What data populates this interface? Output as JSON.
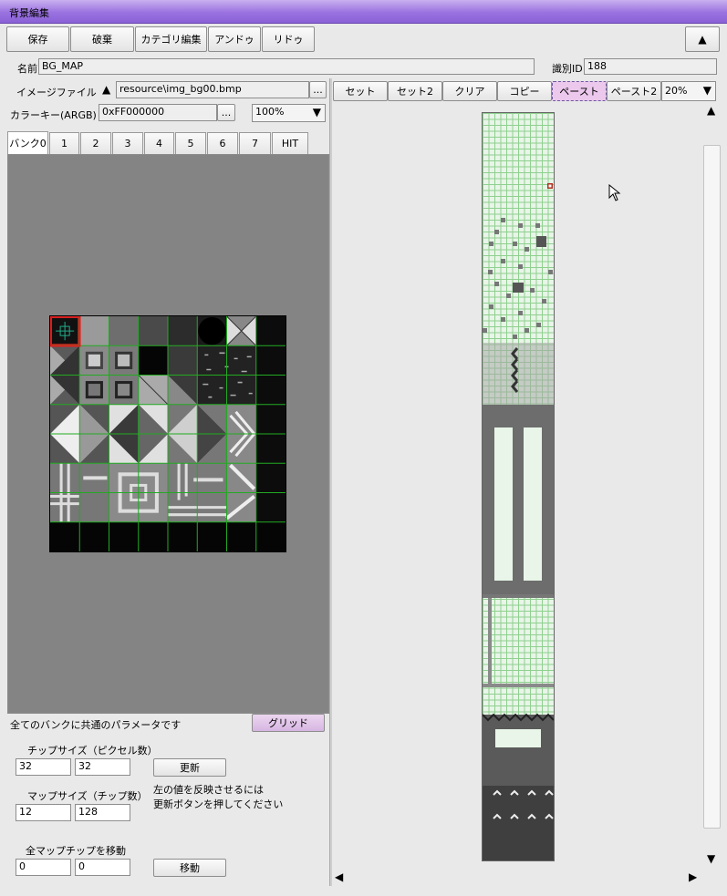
{
  "window": {
    "title": "背景編集"
  },
  "toolbar": {
    "save": "保存",
    "discard": "破棄",
    "category_edit": "カテゴリ編集",
    "undo": "アンドゥ",
    "redo": "リドゥ",
    "collapse": "▲"
  },
  "name_row": {
    "name_label": "名前",
    "name_value": "BG_MAP",
    "id_label": "識別ID",
    "id_value": "188"
  },
  "image_file": {
    "label": "イメージファイル",
    "sort_icon": "▲",
    "path": "resource\\img_bg00.bmp",
    "browse": "..."
  },
  "color_key": {
    "label": "カラーキー(ARGB)",
    "value": "0xFF000000",
    "browse": "...",
    "zoom": "100%",
    "arrow": "▼"
  },
  "bank_tabs": [
    "バンク0",
    "1",
    "2",
    "3",
    "4",
    "5",
    "6",
    "7",
    "HIT"
  ],
  "params": {
    "common_note": "全てのバンクに共通のパラメータです",
    "grid_button": "グリッド",
    "chip_size_label": "チップサイズ（ピクセル数）",
    "chip_w": "32",
    "chip_h": "32",
    "update_button": "更新",
    "map_size_label": "マップサイズ（チップ数）",
    "map_w": "12",
    "map_h": "128",
    "hint_line1": "左の値を反映させるには",
    "hint_line2": "更新ボタンを押してください",
    "move_label": "全マップチップを移動",
    "move_x": "0",
    "move_y": "0",
    "move_button": "移動"
  },
  "map_toolbar": {
    "set": "セット",
    "set2": "セット2",
    "clear": "クリア",
    "copy": "コピー",
    "paste": "ペースト",
    "paste2": "ペースト2",
    "zoom": "20%",
    "arrow": "▼"
  },
  "scroll": {
    "up": "▲",
    "down": "▼",
    "left": "◀",
    "right": "▶"
  },
  "colors": {
    "title_bar": "#9a72e0",
    "grid": "#22aa22",
    "paste_active": "#e8c8f0",
    "map_floor": "#e8f5e8"
  }
}
